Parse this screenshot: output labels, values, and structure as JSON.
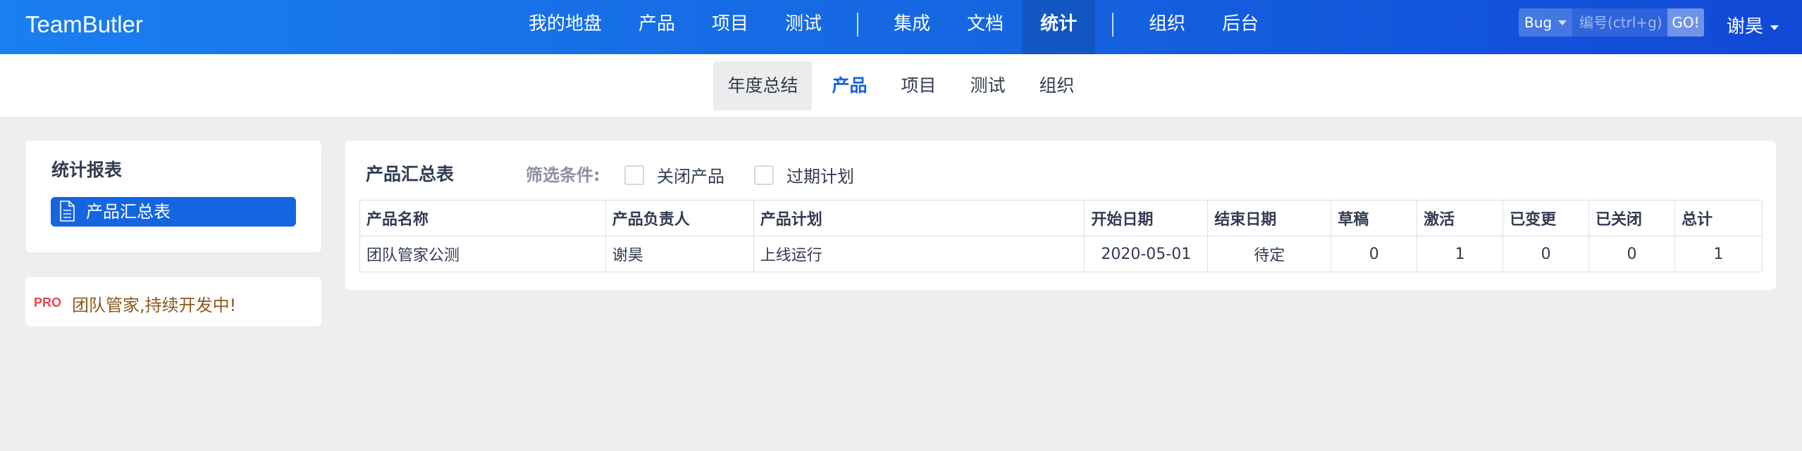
{
  "brand": "TeamButler",
  "main_nav": {
    "group1": [
      "我的地盘",
      "产品",
      "项目",
      "测试"
    ],
    "group2": [
      "集成",
      "文档",
      "统计"
    ],
    "group3": [
      "组织",
      "后台"
    ],
    "active": "统计"
  },
  "search": {
    "type": "Bug",
    "placeholder": "编号(ctrl+g)",
    "go_label": "GO!"
  },
  "user": "谢昊",
  "sub_nav": {
    "items": [
      "年度总结",
      "产品",
      "项目",
      "测试",
      "组织"
    ],
    "active": "产品"
  },
  "sidebar": {
    "title": "统计报表",
    "item": "产品汇总表"
  },
  "promo": {
    "badge": "PRO",
    "text": "团队管家,持续开发中!"
  },
  "report": {
    "title": "产品汇总表",
    "filter_label": "筛选条件:",
    "filters": [
      "关闭产品",
      "过期计划"
    ],
    "columns": [
      "产品名称",
      "产品负责人",
      "产品计划",
      "开始日期",
      "结束日期",
      "草稿",
      "激活",
      "已变更",
      "已关闭",
      "总计"
    ],
    "rows": [
      [
        "团队管家公测",
        "谢昊",
        "上线运行",
        "2020-05-01",
        "待定",
        "0",
        "1",
        "0",
        "0",
        "1"
      ]
    ]
  },
  "colors": {
    "accent": "#1565e0",
    "pro": "#e5484d"
  }
}
